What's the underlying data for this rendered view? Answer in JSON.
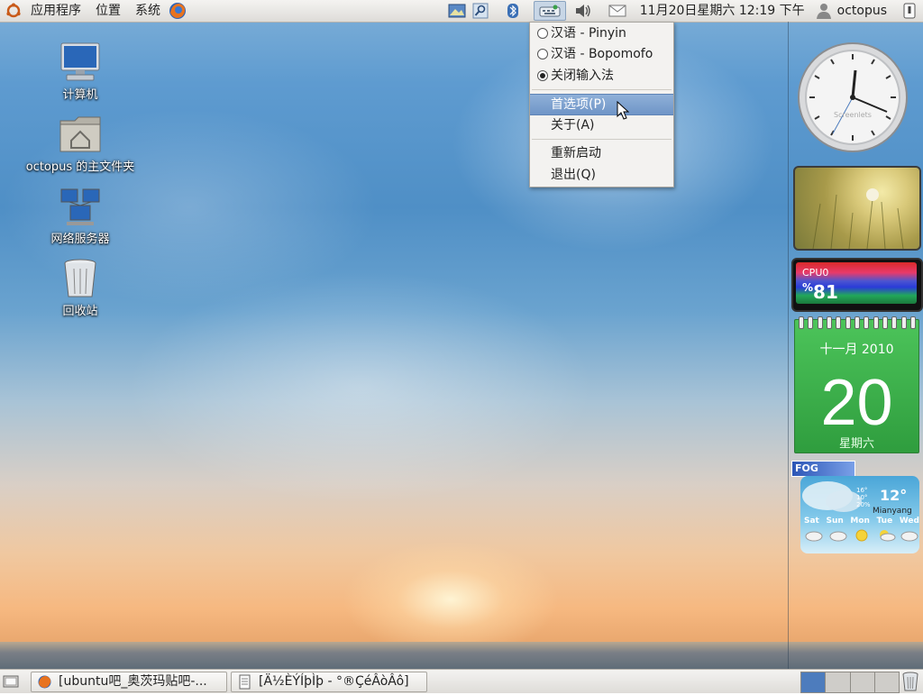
{
  "top_panel": {
    "menus": [
      {
        "id": "applications",
        "label": "应用程序"
      },
      {
        "id": "places",
        "label": "位置"
      },
      {
        "id": "system",
        "label": "系统"
      }
    ],
    "datetime": "11月20日星期六 12:19 下午",
    "user": "octopus"
  },
  "desktop_icons": [
    {
      "label": "计算机"
    },
    {
      "label": "octopus 的主文件夹"
    },
    {
      "label": "网络服务器"
    },
    {
      "label": "回收站"
    }
  ],
  "ime_menu": {
    "items": [
      {
        "label": "汉语 - Pinyin",
        "type": "radio",
        "checked": false
      },
      {
        "label": "汉语 - Bopomofo",
        "type": "radio",
        "checked": false
      },
      {
        "label": "关闭输入法",
        "type": "radio",
        "checked": true
      },
      {
        "label": "首选项(P)",
        "highlighted": true
      },
      {
        "label": "关于(A)"
      },
      {
        "label": "重新启动"
      },
      {
        "label": "退出(Q)"
      }
    ]
  },
  "widgets": {
    "clock": {
      "brand": "Screenlets",
      "time": "12:19"
    },
    "cpu": {
      "label": "CPU0",
      "percent_sign": "%",
      "value": "81"
    },
    "calendar": {
      "month_year": "十一月 2010",
      "day": "20",
      "weekday": "星期六"
    },
    "weather": {
      "tag": "FOG",
      "temp": "12°",
      "small_lines": [
        "16°",
        "10°",
        "20%"
      ],
      "city": "Mianyang",
      "days": [
        "Sat",
        "Sun",
        "Mon",
        "Tue",
        "Wed"
      ]
    }
  },
  "taskbar": {
    "tasks": [
      {
        "label": "[ubuntu吧_奥茨玛贴吧-..."
      },
      {
        "label": "[Ä½ÈÝÍþÌþ - °®ÇéÂòÂô]"
      }
    ]
  },
  "colors": {
    "highlight": "#6f95c7",
    "workspace_active": "#4d7cbd",
    "calendar_green": "#3aae49"
  }
}
